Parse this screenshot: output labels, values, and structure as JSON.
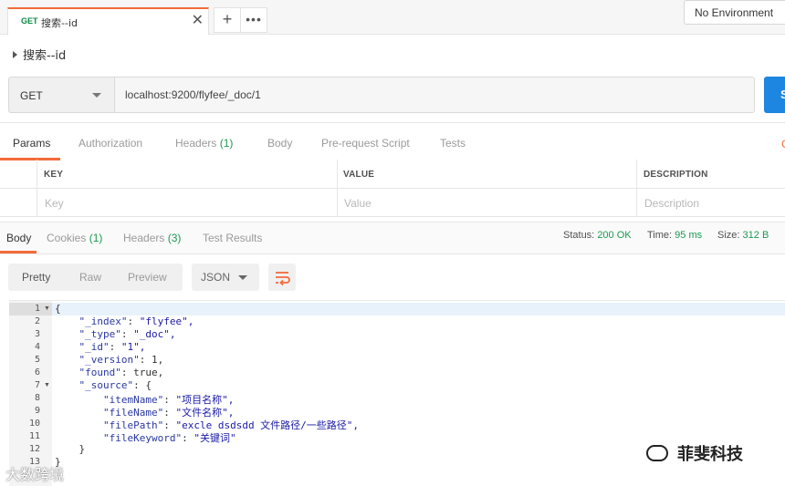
{
  "tab": {
    "method": "GET",
    "name": "搜索--id",
    "close": "✕"
  },
  "tab_actions": {
    "add": "+",
    "more": "•••"
  },
  "environment": "No Environment",
  "request": {
    "title": "搜索--id",
    "method": "GET",
    "url": "localhost:9200/flyfee/_doc/1",
    "send_label": "S"
  },
  "request_tabs": [
    {
      "label": "Params",
      "count": ""
    },
    {
      "label": "Authorization",
      "count": ""
    },
    {
      "label": "Headers",
      "count": "(1)"
    },
    {
      "label": "Body",
      "count": ""
    },
    {
      "label": "Pre-request Script",
      "count": ""
    },
    {
      "label": "Tests",
      "count": ""
    }
  ],
  "cookies_edge": "C",
  "params_table": {
    "headers": [
      "KEY",
      "VALUE",
      "DESCRIPTION"
    ],
    "placeholders": [
      "Key",
      "Value",
      "Description"
    ]
  },
  "response_tabs": [
    {
      "label": "Body",
      "count": ""
    },
    {
      "label": "Cookies",
      "count": "(1)"
    },
    {
      "label": "Headers",
      "count": "(3)"
    },
    {
      "label": "Test Results",
      "count": ""
    }
  ],
  "response_status": {
    "status_label": "Status:",
    "status_value": "200 OK",
    "time_label": "Time:",
    "time_value": "95 ms",
    "size_label": "Size:",
    "size_value": "312 B"
  },
  "view_modes": [
    "Pretty",
    "Raw",
    "Preview"
  ],
  "format": "JSON",
  "wrap_icon": "wrap-lines-icon",
  "code_lines": [
    "{",
    "    \"_index\": \"flyfee\",",
    "    \"_type\": \"_doc\",",
    "    \"_id\": \"1\",",
    "    \"_version\": 1,",
    "    \"found\": true,",
    "    \"_source\": {",
    "        \"itemName\": \"项目名称\",",
    "        \"fileName\": \"文件名称\",",
    "        \"filePath\": \"excle dsdsdd 文件路径/一些路径\",",
    "        \"fileKeyword\": \"关键词\"",
    "    }",
    "}"
  ],
  "watermarks": {
    "right": "菲斐科技",
    "left": "大数跨境"
  },
  "colors": {
    "accent": "#f26b3a",
    "success": "#1b9a4f",
    "send": "#1d86e0"
  }
}
